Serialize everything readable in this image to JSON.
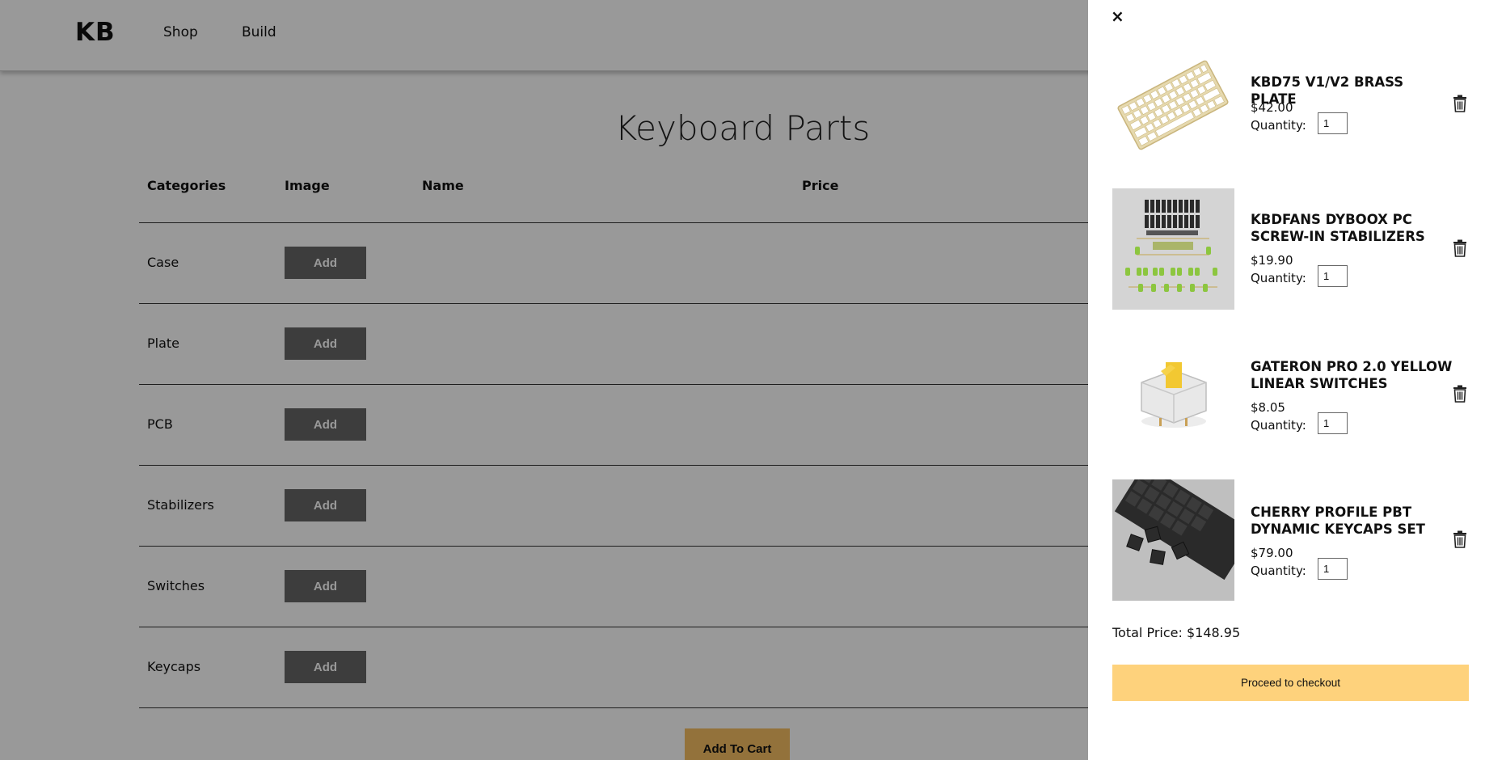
{
  "header": {
    "logo": "KB",
    "nav": [
      "Shop",
      "Build"
    ]
  },
  "main": {
    "title": "Keyboard Parts",
    "columns": [
      "Categories",
      "Image",
      "Name",
      "Price"
    ],
    "rows": [
      {
        "category": "Case",
        "button": "Add"
      },
      {
        "category": "Plate",
        "button": "Add"
      },
      {
        "category": "PCB",
        "button": "Add"
      },
      {
        "category": "Stabilizers",
        "button": "Add"
      },
      {
        "category": "Switches",
        "button": "Add"
      },
      {
        "category": "Keycaps",
        "button": "Add"
      }
    ],
    "add_to_cart_label": "Add To Cart"
  },
  "cart": {
    "close_icon": "×",
    "items": [
      {
        "name": "KBD75 V1/V2 BRASS PLATE",
        "price": "$42.00",
        "qty_label": "Quantity:",
        "qty": "1",
        "image": "brass-plate"
      },
      {
        "name": "KBDFANS DYBOOX PC SCREW-IN STABILIZERS",
        "price": "$19.90",
        "qty_label": "Quantity:",
        "qty": "1",
        "image": "stabilizers"
      },
      {
        "name": "GATERON PRO 2.0 YELLOW LINEAR SWITCHES",
        "price": "$8.05",
        "qty_label": "Quantity:",
        "qty": "1",
        "image": "switch"
      },
      {
        "name": "CHERRY PROFILE PBT DYNAMIC KEYCAPS SET",
        "price": "$79.00",
        "qty_label": "Quantity:",
        "qty": "1",
        "image": "keycaps"
      }
    ],
    "total": "Total Price: $148.95",
    "checkout_label": "Proceed to checkout",
    "colors": {
      "checkout": "#fed27c",
      "add_to_cart": "#f5bf63",
      "add_button": "#666666",
      "overlay": "rgba(0,0,0,0.4)"
    }
  }
}
